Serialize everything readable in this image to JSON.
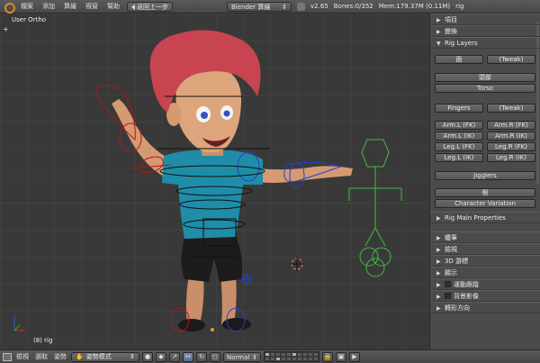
{
  "top_bar": {
    "menus": [
      "檔案",
      "添加",
      "算繪",
      "視窗",
      "幫助"
    ],
    "back_button": "返回上一步",
    "engine": "Blender 算繪",
    "version": "v2.65",
    "bones": "Bones:0/352",
    "mem": "Mem:179.37M (0.11M)",
    "object": "rig"
  },
  "viewport": {
    "view_label": "User Ortho",
    "object_label": "(8) rig",
    "plus": "+"
  },
  "panel": {
    "sections_top": [
      "項目",
      "變換"
    ],
    "rig_layers": {
      "title": "Rig Layers",
      "face_row": [
        "面",
        "(Tweak)"
      ],
      "head": "頭部",
      "torso": "Torso",
      "fingers_row": [
        "Fingers",
        "(Tweak)"
      ],
      "arm_fk_row": [
        "Arm.L (FK)",
        "Arm.R (FK)"
      ],
      "arm_ik_row": [
        "Arm.L (IK)",
        "Arm.R (IK)"
      ],
      "leg_fk_row": [
        "Leg.L (FK)",
        "Leg.R (FK)"
      ],
      "leg_ik_row": [
        "Leg.L (IK)",
        "Leg.R (IK)"
      ],
      "jigglers": "Jigglers",
      "root": "根",
      "character_variation": "Character Variation"
    },
    "rig_main": "Rig Main Properties",
    "sections_bottom": [
      "蠟筆",
      "檢視",
      "3D 游標",
      "顯示"
    ],
    "motion_tracking": "運動跟蹤",
    "background_images": "背景影像",
    "transform_orientation": "轉形方向"
  },
  "bottom_bar": {
    "menus": [
      "檢視",
      "選取",
      "姿勢"
    ],
    "mode": "姿勢模式",
    "pivot": "Normal"
  },
  "colors": {
    "viewport_bg": "#393939",
    "panel_bg": "#4b4b4b",
    "hair": "#c84450",
    "shirt": "#1f8da8",
    "skin": "#d9a27a",
    "bone_green": "#3fbf3f",
    "bone_red": "#b01818",
    "bone_blue": "#2840c8"
  }
}
